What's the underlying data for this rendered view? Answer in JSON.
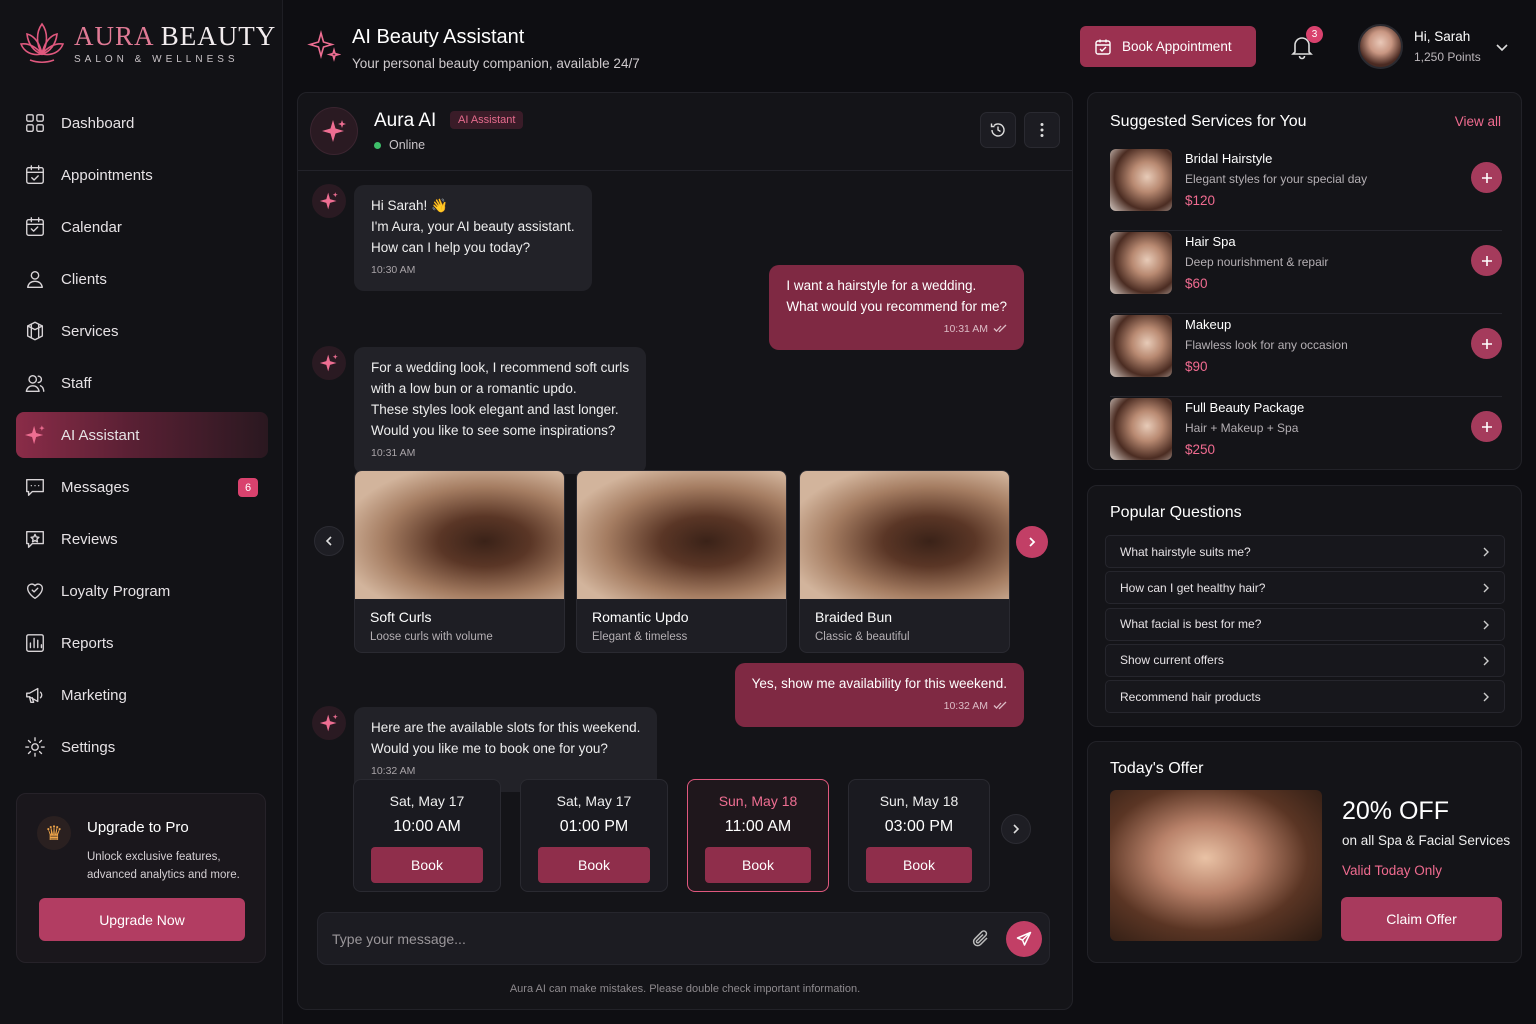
{
  "brand": {
    "name_part1": "AURA",
    "name_part2": "BEAUTY",
    "tagline": "SALON & WELLNESS"
  },
  "sidebar": {
    "items": [
      {
        "label": "Dashboard",
        "icon": "grid-icon"
      },
      {
        "label": "Appointments",
        "icon": "calendar-check-icon"
      },
      {
        "label": "Calendar",
        "icon": "calendar-icon"
      },
      {
        "label": "Clients",
        "icon": "user-icon"
      },
      {
        "label": "Services",
        "icon": "box-icon"
      },
      {
        "label": "Staff",
        "icon": "users-icon"
      },
      {
        "label": "AI Assistant",
        "icon": "sparkle-icon",
        "active": true
      },
      {
        "label": "Messages",
        "icon": "message-icon",
        "badge": "6"
      },
      {
        "label": "Reviews",
        "icon": "star-message-icon"
      },
      {
        "label": "Loyalty Program",
        "icon": "heart-icon"
      },
      {
        "label": "Reports",
        "icon": "chart-icon"
      },
      {
        "label": "Marketing",
        "icon": "megaphone-icon"
      },
      {
        "label": "Settings",
        "icon": "gear-icon"
      }
    ]
  },
  "upgrade": {
    "title": "Upgrade to Pro",
    "desc_line1": "Unlock exclusive features,",
    "desc_line2": "advanced analytics and more.",
    "button": "Upgrade Now"
  },
  "header": {
    "title": "AI Beauty Assistant",
    "subtitle": "Your personal beauty companion, available 24/7",
    "book_button": "Book Appointment",
    "notif_count": "3",
    "user_greeting": "Hi, Sarah",
    "user_points": "1,250 Points"
  },
  "chat": {
    "bot_name": "Aura AI",
    "bot_tag": "AI Assistant",
    "status": "Online",
    "messages": [
      {
        "from": "bot",
        "lines": [
          "Hi Sarah! 👋",
          "I'm Aura, your AI beauty assistant.",
          "How can I help you today?"
        ],
        "time": "10:30 AM"
      },
      {
        "from": "user",
        "lines": [
          "I want a hairstyle for a wedding.",
          "What would you recommend for me?"
        ],
        "time": "10:31 AM"
      },
      {
        "from": "bot",
        "lines": [
          "For a wedding look, I recommend soft curls",
          "with a low bun or a romantic updo.",
          "These styles look elegant and last longer.",
          "Would you like to see some inspirations?"
        ],
        "time": "10:31 AM"
      },
      {
        "from": "user",
        "lines": [
          "Yes, show me availability for this weekend."
        ],
        "time": "10:32 AM"
      },
      {
        "from": "bot",
        "lines": [
          "Here are the available slots for this weekend.",
          "Would you like me to book one for you?"
        ],
        "time": "10:32 AM"
      }
    ],
    "styles": [
      {
        "title": "Soft Curls",
        "desc": "Loose curls with volume"
      },
      {
        "title": "Romantic Updo",
        "desc": "Elegant & timeless"
      },
      {
        "title": "Braided Bun",
        "desc": "Classic & beautiful"
      }
    ],
    "slots": [
      {
        "date": "Sat, May 17",
        "time": "10:00 AM",
        "button": "Book"
      },
      {
        "date": "Sat, May 17",
        "time": "01:00 PM",
        "button": "Book"
      },
      {
        "date": "Sun, May 18",
        "time": "11:00 AM",
        "button": "Book",
        "selected": true
      },
      {
        "date": "Sun, May 18",
        "time": "03:00 PM",
        "button": "Book"
      }
    ],
    "input_placeholder": "Type your message...",
    "disclaimer": "Aura AI can make mistakes. Please double check important information."
  },
  "suggested": {
    "title": "Suggested Services for You",
    "view_all": "View all",
    "items": [
      {
        "name": "Bridal Hairstyle",
        "desc": "Elegant styles for your special day",
        "price": "$120"
      },
      {
        "name": "Hair Spa",
        "desc": "Deep nourishment & repair",
        "price": "$60"
      },
      {
        "name": "Makeup",
        "desc": "Flawless look for any occasion",
        "price": "$90"
      },
      {
        "name": "Full Beauty Package",
        "desc": "Hair + Makeup + Spa",
        "price": "$250"
      }
    ]
  },
  "questions": {
    "title": "Popular Questions",
    "items": [
      "What hairstyle suits me?",
      "How can I get healthy hair?",
      "What facial is best for me?",
      "Show current offers",
      "Recommend hair products"
    ]
  },
  "offer": {
    "title": "Today's Offer",
    "big": "20% OFF",
    "sub": "on all Spa & Facial Services",
    "valid": "Valid Today Only",
    "button": "Claim Offer"
  },
  "colors": {
    "accent": "#e0587e",
    "accent_dark": "#8f2e4b",
    "background": "#0e0e12",
    "panel": "#141418"
  }
}
